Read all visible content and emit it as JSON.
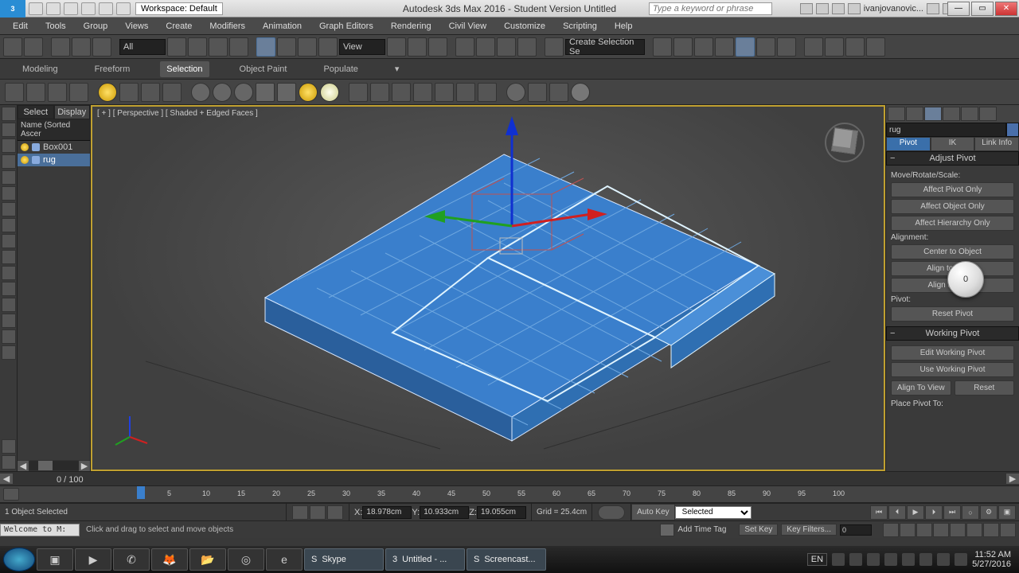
{
  "titlebar": {
    "workspace_label": "Workspace: Default",
    "app_title": "Autodesk 3ds Max 2016 - Student Version   Untitled",
    "search_placeholder": "Type a keyword or phrase",
    "account_name": "ivanjovanovic...",
    "win_min": "—",
    "win_max": "▭",
    "win_close": "✕"
  },
  "menubar": [
    "Edit",
    "Tools",
    "Group",
    "Views",
    "Create",
    "Modifiers",
    "Animation",
    "Graph Editors",
    "Rendering",
    "Civil View",
    "Customize",
    "Scripting",
    "Help"
  ],
  "toolbar1": {
    "dropdown_all": "All",
    "dropdown_view": "View",
    "dropdown_selset": "Create Selection Se"
  },
  "ribbon_tabs": [
    "Modeling",
    "Freeform",
    "Selection",
    "Object Paint",
    "Populate"
  ],
  "ribbon_selected": "Selection",
  "scene_explorer": {
    "tab_select": "Select",
    "tab_display": "Display",
    "header": "Name (Sorted Ascer",
    "items": [
      {
        "name": "Box001",
        "selected": false
      },
      {
        "name": "rug",
        "selected": true
      }
    ]
  },
  "viewport": {
    "label": "[ + ] [ Perspective ] [ Shaded + Edged Faces ]"
  },
  "command_panel": {
    "object_name": "rug",
    "tabs": {
      "pivot": "Pivot",
      "ik": "IK",
      "linkinfo": "Link Info"
    },
    "roll_adjust_pivot": "Adjust Pivot",
    "label_mrs": "Move/Rotate/Scale:",
    "btn_affect_pivot": "Affect Pivot Only",
    "btn_affect_object": "Affect Object Only",
    "btn_affect_hier": "Affect Hierarchy Only",
    "label_alignment": "Alignment:",
    "btn_center_obj": "Center to Object",
    "btn_align_obj": "Align to Object",
    "btn_align_world": "Align to World",
    "label_pivot": "Pivot:",
    "btn_reset_pivot": "Reset Pivot",
    "roll_working_pivot": "Working Pivot",
    "btn_edit_wp": "Edit Working Pivot",
    "btn_use_wp": "Use Working Pivot",
    "btn_align_view": "Align To View",
    "btn_reset": "Reset",
    "label_place_pivot": "Place Pivot To:"
  },
  "timeslider": {
    "frame_label": "0 / 100",
    "ticks": [
      5,
      10,
      15,
      20,
      25,
      30,
      35,
      40,
      45,
      50,
      55,
      60,
      65,
      70,
      75,
      80,
      85,
      90,
      95,
      100
    ]
  },
  "status": {
    "selection": "1 Object Selected",
    "x_label": "X:",
    "x_val": "18.978cm",
    "y_label": "Y:",
    "y_val": "10.933cm",
    "z_label": "Z:",
    "z_val": "19.055cm",
    "grid": "Grid = 25.4cm",
    "autokey": "Auto Key",
    "key_object": "Selected",
    "setkey": "Set Key",
    "keyfilters": "Key Filters...",
    "frame_spin": "0"
  },
  "status2": {
    "welcome": "Welcome to M:",
    "prompt": "Click and drag to select and move objects",
    "add_time_tag": "Add Time Tag"
  },
  "taskbar": {
    "apps": [
      {
        "glyph": "▣"
      },
      {
        "glyph": "▶"
      },
      {
        "glyph": "✆"
      },
      {
        "glyph": "🦊"
      },
      {
        "glyph": "📂"
      },
      {
        "glyph": "◎"
      },
      {
        "glyph": "e"
      }
    ],
    "wide": [
      {
        "label": "Skype",
        "glyph": "S"
      },
      {
        "label": "Untitled - ...",
        "glyph": "3"
      },
      {
        "label": "Screencast...",
        "glyph": "S"
      }
    ],
    "lang": "EN",
    "time": "11:52 AM",
    "date": "5/27/2016"
  },
  "cursor_bubble": "0"
}
